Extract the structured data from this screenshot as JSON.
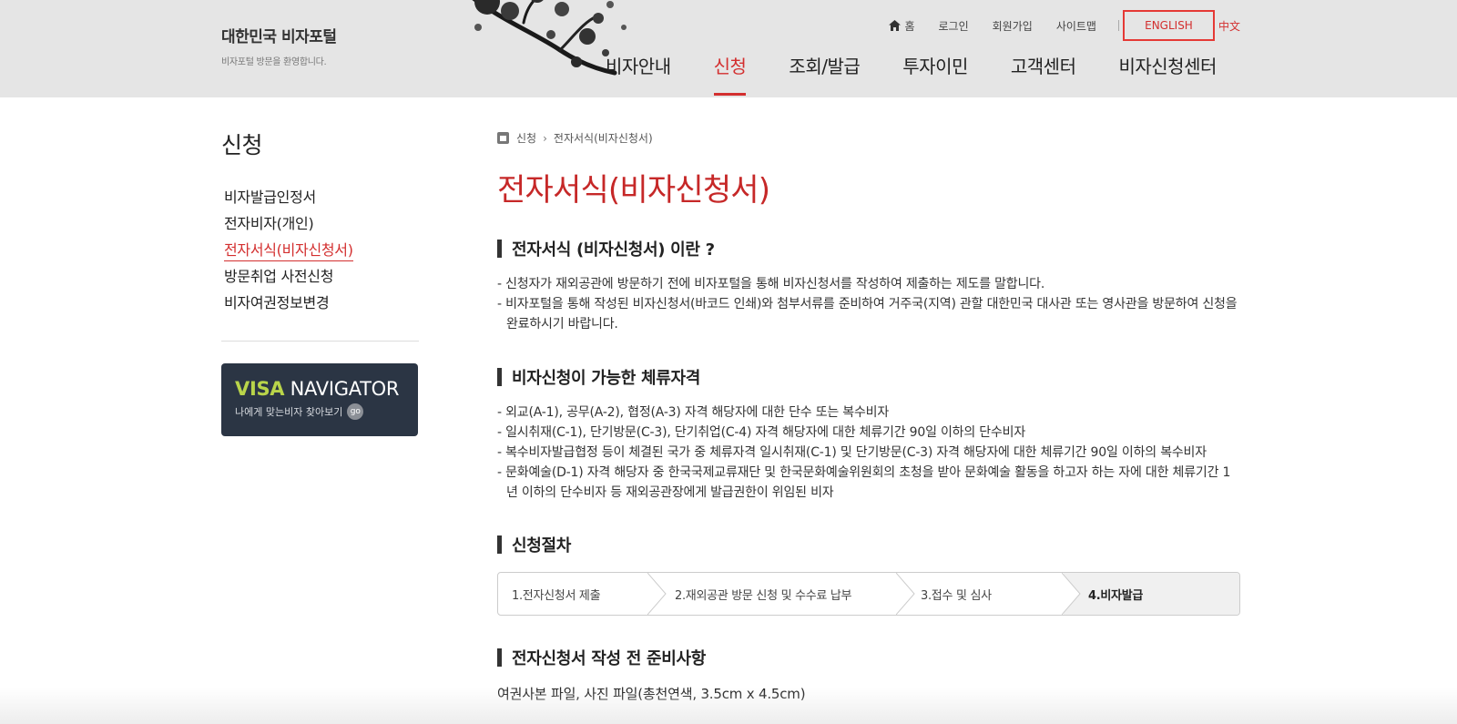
{
  "header": {
    "logo_title": "대한민국 비자포털",
    "logo_subtitle": "비자포털 방문을 환영합니다.",
    "util": {
      "home": "홈",
      "login": "로그인",
      "signup": "회원가입",
      "sitemap": "사이트맵",
      "english": "ENGLISH",
      "chinese": "中文"
    },
    "gnb": [
      {
        "label": "비자안내",
        "active": false
      },
      {
        "label": "신청",
        "active": true
      },
      {
        "label": "조회/발급",
        "active": false
      },
      {
        "label": "투자이민",
        "active": false
      },
      {
        "label": "고객센터",
        "active": false
      },
      {
        "label": "비자신청센터",
        "active": false
      }
    ]
  },
  "sidebar": {
    "title": "신청",
    "items": [
      {
        "label": "비자발급인정서",
        "active": false
      },
      {
        "label": "전자비자(개인)",
        "active": false
      },
      {
        "label": "전자서식(비자신청서)",
        "active": true
      },
      {
        "label": "방문취업 사전신청",
        "active": false
      },
      {
        "label": "비자여권정보변경",
        "active": false
      }
    ],
    "visa_navigator": {
      "title_accent": "VISA",
      "title_rest": "NAVIGATOR",
      "subtitle": "나에게 맞는비자 찾아보기",
      "go": "go"
    }
  },
  "breadcrumb": {
    "level1": "신청",
    "level2": "전자서식(비자신청서)"
  },
  "page_title": "전자서식(비자신청서)",
  "sections": {
    "intro": {
      "heading": "전자서식 (비자신청서) 이란 ?",
      "items": [
        "신청자가 재외공관에 방문하기 전에 비자포털을 통해 비자신청서를 작성하여 제출하는 제도를 말합니다.",
        "비자포털을 통해 작성된 비자신청서(바코드 인쇄)와 첨부서류를 준비하여 거주국(지역) 관할 대한민국 대사관 또는 영사관을 방문하여 신청을 완료하시기 바랍니다."
      ]
    },
    "eligible": {
      "heading": "비자신청이 가능한 체류자격",
      "items": [
        "외교(A-1), 공무(A-2), 협정(A-3) 자격 해당자에 대한 단수 또는 복수비자",
        "일시취재(C-1), 단기방문(C-3), 단기취업(C-4) 자격 해당자에 대한 체류기간 90일 이하의 단수비자",
        "복수비자발급협정 등이 체결된 국가 중 체류자격 일시취재(C-1) 및 단기방문(C-3) 자격 해당자에 대한 체류기간 90일 이하의 복수비자",
        "문화예술(D-1) 자격 해당자 중 한국국제교류재단 및 한국문화예술위원회의 초청을 받아 문화예술 활동을 하고자 하는 자에 대한 체류기간 1년 이하의 단수비자 등 재외공관장에게 발급권한이 위임된 비자"
      ]
    },
    "procedure": {
      "heading": "신청절차",
      "steps": [
        "1.전자신청서 제출",
        "2.재외공관 방문 신청 및 수수료 납부",
        "3.접수 및 심사",
        "4.비자발급"
      ]
    },
    "preparation": {
      "heading": "전자신청서 작성 전 준비사항",
      "text": "여권사본 파일, 사진 파일(총천연색, 3.5cm x 4.5cm)"
    }
  },
  "colors": {
    "accent_red": "#d32f2f",
    "header_bg": "#e5e5e5",
    "navigator_bg": "#2b3544",
    "navigator_accent": "#b9d44a"
  }
}
